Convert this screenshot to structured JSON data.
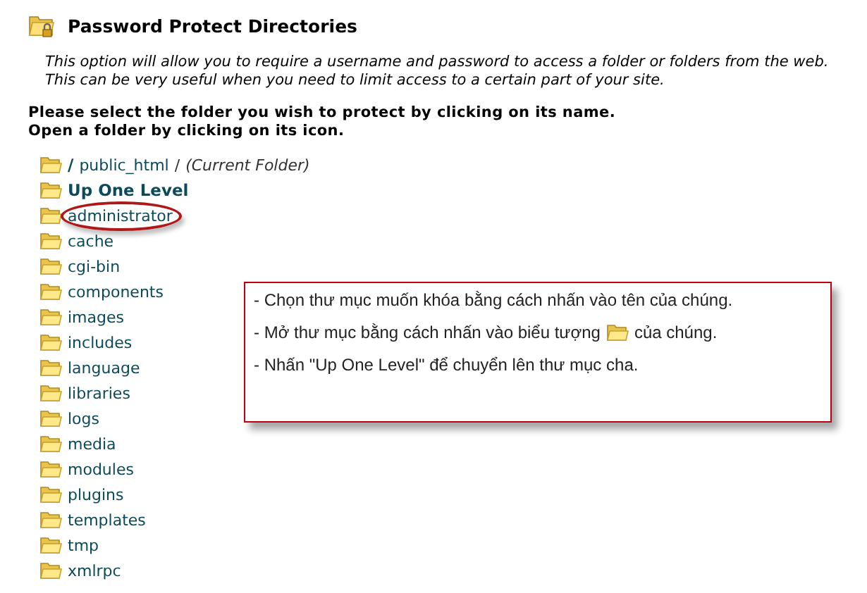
{
  "header": {
    "title": "Password Protect Directories"
  },
  "description": "This option will allow you to require a username and password to access a folder or folders from the web. This can be very useful when you need to limit access to a certain part of your site.",
  "instructions": [
    "Please select the folder you wish to protect by clicking on its name.",
    "Open a folder by clicking on its icon."
  ],
  "path": {
    "root": "/",
    "folder": "public_html",
    "separator": "/",
    "note": "(Current Folder)"
  },
  "up_level": "Up One Level",
  "folders": [
    {
      "name": "administrator",
      "circled": true
    },
    {
      "name": "cache",
      "circled": false
    },
    {
      "name": "cgi-bin",
      "circled": false
    },
    {
      "name": "components",
      "circled": false
    },
    {
      "name": "images",
      "circled": false
    },
    {
      "name": "includes",
      "circled": false
    },
    {
      "name": "language",
      "circled": false
    },
    {
      "name": "libraries",
      "circled": false
    },
    {
      "name": "logs",
      "circled": false
    },
    {
      "name": "media",
      "circled": false
    },
    {
      "name": "modules",
      "circled": false
    },
    {
      "name": "plugins",
      "circled": false
    },
    {
      "name": "templates",
      "circled": false
    },
    {
      "name": "tmp",
      "circled": false
    },
    {
      "name": "xmlrpc",
      "circled": false
    }
  ],
  "callout": {
    "lines": [
      {
        "kind": "text",
        "text": "- Chọn thư mục muốn khóa bằng cách nhấn vào tên của chúng."
      },
      {
        "kind": "icon",
        "before": "- Mở thư mục bằng cách nhấn vào biểu tượng",
        "after": "của chúng."
      },
      {
        "kind": "text",
        "text": "- Nhấn \"Up One Level\" để chuyển lên thư mục cha."
      }
    ]
  }
}
